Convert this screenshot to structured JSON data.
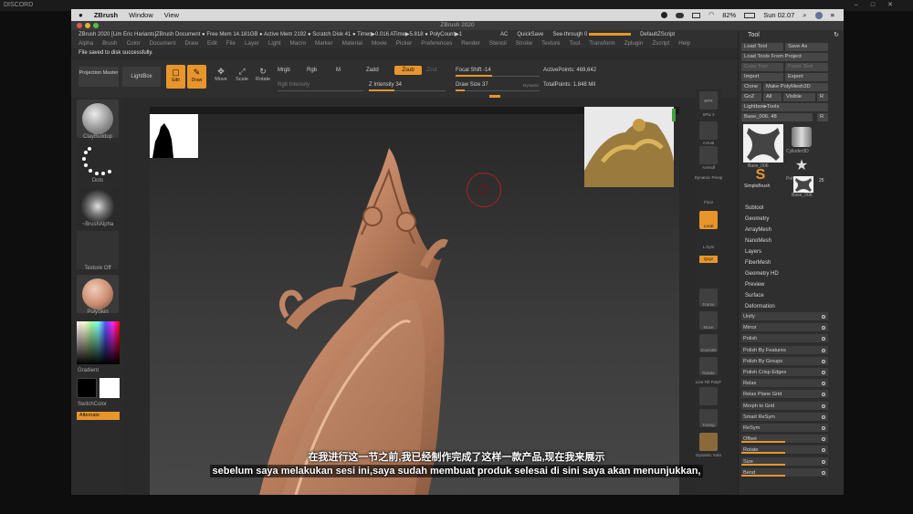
{
  "outer": {
    "title": "DISCORD",
    "window_controls": [
      "–",
      "□",
      "✕"
    ]
  },
  "macbar": {
    "apple": "",
    "app_name": "ZBrush",
    "menus": [
      "Window",
      "View"
    ],
    "battery": "82%",
    "clock": "Sun 02.07"
  },
  "titlebar": {
    "title": "ZBrush 2020"
  },
  "infobar": {
    "text": "ZBrush 2020 [Lim Eric Hariants]ZBrush Document   ● Free Mem 14.181GB ● Active Mem 2192 ● Scratch Disk 41 ● Timer▶0.016 ATime▶5.818 ● PolyCount▶1",
    "ac": "AC",
    "quicksave": "QuickSave",
    "see_through": "See-through  0",
    "defaultzscript": "DefaultZScript",
    "menus_label": "Menus"
  },
  "menubar": [
    "Alpha",
    "Brush",
    "Color",
    "Document",
    "Draw",
    "Edit",
    "File",
    "Layer",
    "Light",
    "Macro",
    "Marker",
    "Material",
    "Movie",
    "Picker",
    "Preferences",
    "Render",
    "Stencil",
    "Stroke",
    "Texture",
    "Tool",
    "Transform",
    "Zplugin",
    "Zscript",
    "Help"
  ],
  "status": "File saved to disk successfully.",
  "toolbar": {
    "projection_master": "Projection Master",
    "lightbox": "LightBox",
    "edit": "Edit",
    "draw": "Draw",
    "move": "Move",
    "scale": "Scale",
    "rotate": "Rotate",
    "mrgb": "Mrgb",
    "rgb": "Rgb",
    "m": "M",
    "zadd": "Zadd",
    "zsub": "Zsub",
    "zcut": "Zcut",
    "rgb_intensity": "Rgb Intensity",
    "z_intensity": "Z Intensity 34",
    "focal_shift": "Focal Shift -14",
    "draw_size": "Draw Size 37",
    "dynamic": "Dynamic",
    "active_points": "ActivePoints: 469,642",
    "total_points": "TotalPoints: 1.848 Mil"
  },
  "leftshelf": {
    "brush": "ClayBuildup",
    "stroke": "Dots",
    "alpha": "~BrushAlpha",
    "texture": "Texture Off",
    "material": "PolySkin",
    "gradient": "Gradient",
    "switchcolor": "SwitchColor",
    "alternate": "Alternate"
  },
  "rightshelf": [
    "BPR",
    "SPix 3",
    "Actual",
    "AAHalf",
    "Dynamic Persp",
    "Floor",
    "Local",
    "L.Sym",
    "Qxyz",
    "Frame",
    "Move",
    "Zoom3D",
    "Rotate",
    "Line Fill PolyF",
    "Transp",
    "Dynamic Solo"
  ],
  "panel": {
    "title": "Tool",
    "load_tool": "Load Tool",
    "save_as": "Save As",
    "load_tools_from_project": "Load Tools From Project",
    "copy_tool": "Copy Tool",
    "paste_tool": "Paste Tool",
    "import": "Import",
    "export": "Export",
    "clone": "Clone",
    "make_polymesh3d": "Make PolyMesh3D",
    "goz": "GoZ",
    "all": "All",
    "visible": "Visible",
    "r": "R",
    "lightbox_tools": "Lightbox▸Tools",
    "current_tool": "Base_006. 48",
    "thumbs": [
      "Base_006",
      "Cylinder3D",
      "SimpleBrush",
      "PolyMesh3D",
      "Base_006"
    ],
    "thumb_count": "25",
    "subpalettes": [
      "Subtool",
      "Geometry",
      "ArrayMesh",
      "NanoMesh",
      "Layers",
      "FiberMesh",
      "Geometry HD",
      "Preview",
      "Surface",
      "Deformation"
    ],
    "deformation": [
      {
        "label": "Unify",
        "fill": 0.0
      },
      {
        "label": "Mirror",
        "fill": 0.0
      },
      {
        "label": "Polish",
        "fill": 0.0
      },
      {
        "label": "Polish By Features",
        "fill": 0.0
      },
      {
        "label": "Polish By Groups",
        "fill": 0.0
      },
      {
        "label": "Polish Crisp Edges",
        "fill": 0.0
      },
      {
        "label": "Relax",
        "fill": 0.0
      },
      {
        "label": "Relax Plane Grid",
        "fill": 0.0
      },
      {
        "label": "Morph to Grid",
        "fill": 0.0
      },
      {
        "label": "Smart ReSym",
        "fill": 0.0
      },
      {
        "label": "ReSym",
        "fill": 0.0
      },
      {
        "label": "Offset",
        "fill": 0.5
      },
      {
        "label": "Rotate",
        "fill": 0.5
      },
      {
        "label": "Size",
        "fill": 0.5
      },
      {
        "label": "Bend",
        "fill": 0.5
      }
    ]
  },
  "subtitles": {
    "line1": "在我进行这一节之前,我已经制作完成了这样一款产品,现在我来展示",
    "line2": "sebelum saya melakukan sesi ini,saya sudah membuat produk selesai di sini saya akan menunjukkan,"
  },
  "colors": {
    "accent": "#e8952c",
    "panel": "#2f2f2f",
    "model": "#b9805f"
  }
}
